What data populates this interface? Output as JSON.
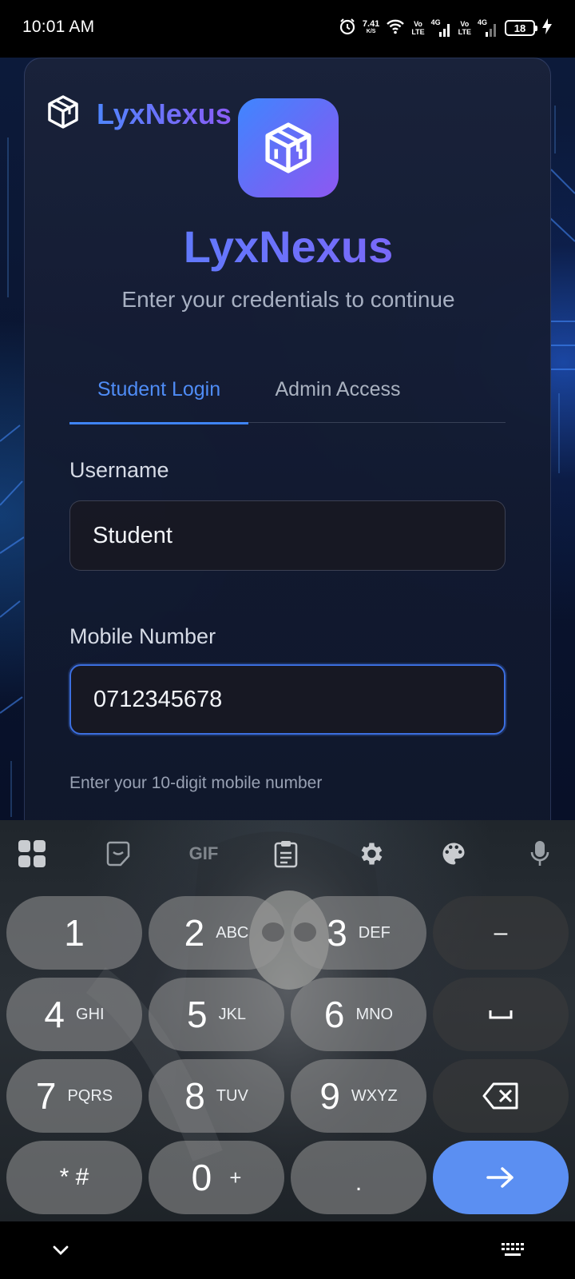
{
  "status_bar": {
    "time": "10:01 AM",
    "speed_value": "7.41",
    "speed_unit": "K/S",
    "sim1_top": "Vo",
    "sim1_bottom": "LTE",
    "sim1_gen": "4G",
    "sim2_top": "Vo",
    "sim2_bottom": "LTE",
    "sim2_gen": "4G",
    "battery": "18",
    "icons": [
      "alarm-icon",
      "wifi-icon",
      "signal-icon",
      "battery-icon",
      "charging-icon"
    ]
  },
  "app": {
    "brand_name": "LyxNexus",
    "title": "LyxNexus",
    "subtitle": "Enter your credentials to continue",
    "tabs": [
      {
        "label": "Student Login",
        "active": true
      },
      {
        "label": "Admin Access",
        "active": false
      }
    ],
    "username": {
      "label": "Username",
      "value": "Student"
    },
    "mobile": {
      "label": "Mobile Number",
      "value": "0712345678",
      "hint": "Enter your 10-digit mobile number"
    },
    "colors": {
      "accent_blue": "#4f86ff",
      "accent_purple": "#8b5cf6",
      "tab_active": "#4f8cf6"
    }
  },
  "keyboard": {
    "toolbar": [
      "apps-grid-icon",
      "sticker-icon",
      "gif-icon",
      "clipboard-icon",
      "settings-icon",
      "palette-icon",
      "mic-icon"
    ],
    "gif_label": "GIF",
    "keys": {
      "k1": {
        "num": "1",
        "letters": ""
      },
      "k2": {
        "num": "2",
        "letters": "ABC"
      },
      "k3": {
        "num": "3",
        "letters": "DEF"
      },
      "k4": {
        "num": "4",
        "letters": "GHI"
      },
      "k5": {
        "num": "5",
        "letters": "JKL"
      },
      "k6": {
        "num": "6",
        "letters": "MNO"
      },
      "k7": {
        "num": "7",
        "letters": "PQRS"
      },
      "k8": {
        "num": "8",
        "letters": "TUV"
      },
      "k9": {
        "num": "9",
        "letters": "WXYZ"
      },
      "k0": {
        "num": "0",
        "letters": "+"
      },
      "star": "* #",
      "dot": ".",
      "minus": "–"
    },
    "enter_color": "#5b8ff2"
  }
}
